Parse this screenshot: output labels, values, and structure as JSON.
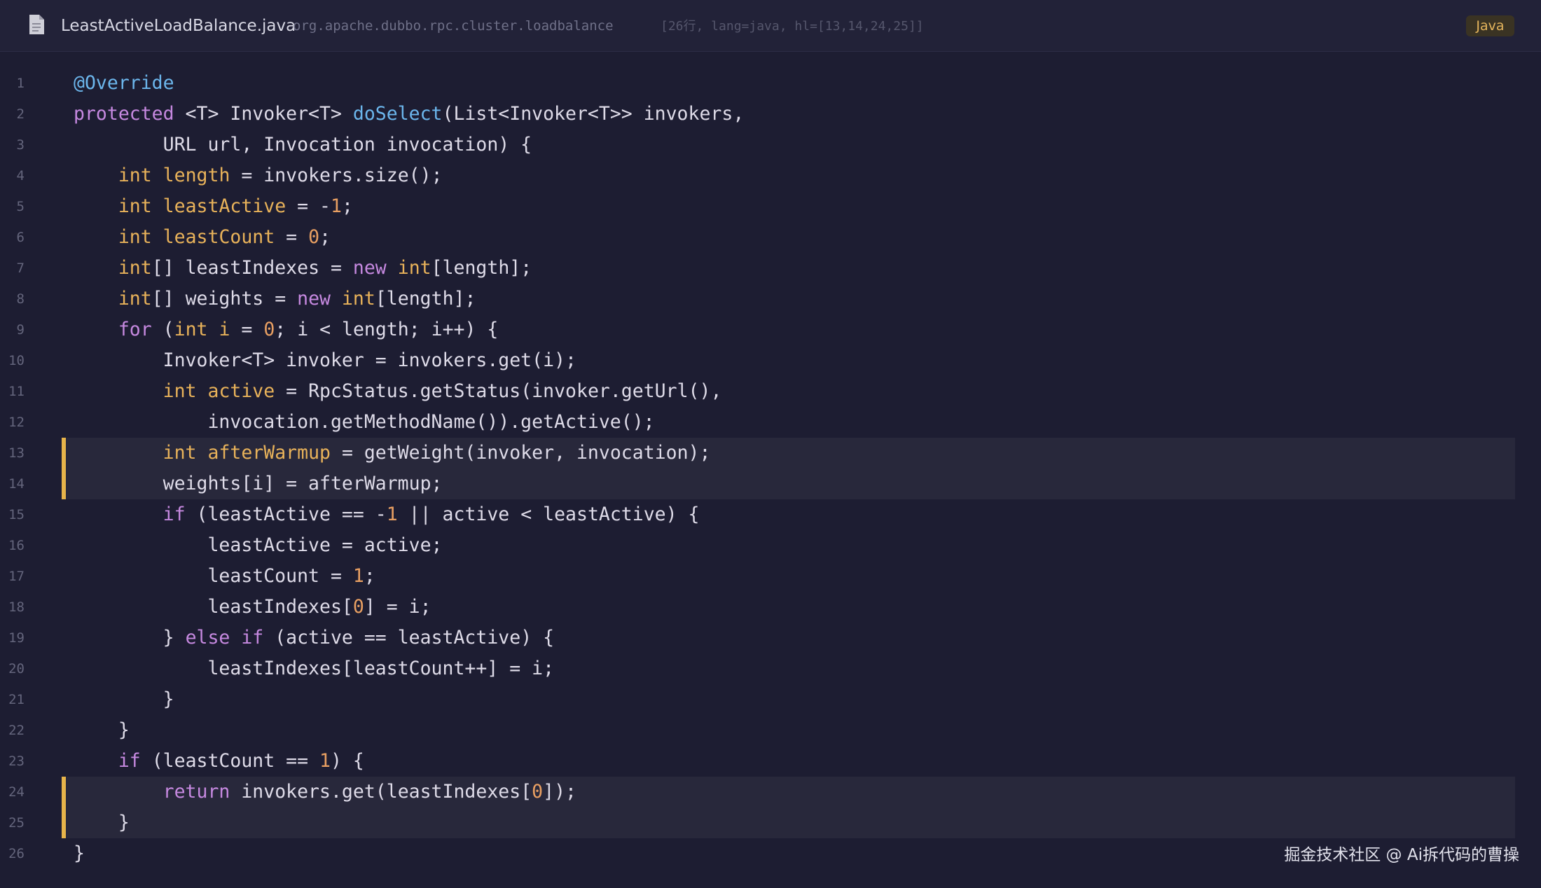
{
  "header": {
    "file_icon": "file-icon",
    "file_name": "LeastActiveLoadBalance.java",
    "package": "org.apache.dubbo.rpc.cluster.loadbalance",
    "meta": "[26行, lang=java, hl=[13,14,24,25]]",
    "language": "Java"
  },
  "colors": {
    "background": "#1d1d32",
    "header": "#222238",
    "highlight_bar": "#e7b44a",
    "keyword": "#c689e0",
    "type": "#e8b25a",
    "function": "#6cb6ec",
    "number": "#e89f62"
  },
  "highlighted_lines": [
    13,
    14,
    24,
    25
  ],
  "lines": [
    {
      "n": "1",
      "indent": "",
      "tokens": [
        [
          "an",
          "@Override"
        ]
      ]
    },
    {
      "n": "2",
      "indent": "",
      "tokens": [
        [
          "kw",
          "protected"
        ],
        [
          "p",
          " <T> Invoker<T> "
        ],
        [
          "fn",
          "doSelect"
        ],
        [
          "p",
          "(List<Invoker<T>> invokers,"
        ]
      ]
    },
    {
      "n": "3",
      "indent": "        ",
      "tokens": [
        [
          "p",
          "URL url, Invocation invocation) {"
        ]
      ]
    },
    {
      "n": "4",
      "indent": "    ",
      "tokens": [
        [
          "ty",
          "int"
        ],
        [
          "p",
          " "
        ],
        [
          "vr",
          "length"
        ],
        [
          "p",
          " = invokers.size();"
        ]
      ]
    },
    {
      "n": "5",
      "indent": "    ",
      "tokens": [
        [
          "ty",
          "int"
        ],
        [
          "p",
          " "
        ],
        [
          "vr",
          "leastActive"
        ],
        [
          "p",
          " = -"
        ],
        [
          "nm",
          "1"
        ],
        [
          "p",
          ";"
        ]
      ]
    },
    {
      "n": "6",
      "indent": "    ",
      "tokens": [
        [
          "ty",
          "int"
        ],
        [
          "p",
          " "
        ],
        [
          "vr",
          "leastCount"
        ],
        [
          "p",
          " = "
        ],
        [
          "nm",
          "0"
        ],
        [
          "p",
          ";"
        ]
      ]
    },
    {
      "n": "7",
      "indent": "    ",
      "tokens": [
        [
          "ty",
          "int"
        ],
        [
          "p",
          "[] leastIndexes = "
        ],
        [
          "kw",
          "new"
        ],
        [
          "p",
          " "
        ],
        [
          "ty",
          "int"
        ],
        [
          "p",
          "[length];"
        ]
      ]
    },
    {
      "n": "8",
      "indent": "    ",
      "tokens": [
        [
          "ty",
          "int"
        ],
        [
          "p",
          "[] weights = "
        ],
        [
          "kw",
          "new"
        ],
        [
          "p",
          " "
        ],
        [
          "ty",
          "int"
        ],
        [
          "p",
          "[length];"
        ]
      ]
    },
    {
      "n": "9",
      "indent": "    ",
      "tokens": [
        [
          "kw",
          "for"
        ],
        [
          "p",
          " ("
        ],
        [
          "ty",
          "int"
        ],
        [
          "p",
          " "
        ],
        [
          "vr",
          "i"
        ],
        [
          "p",
          " = "
        ],
        [
          "nm",
          "0"
        ],
        [
          "p",
          "; i < length; i++) {"
        ]
      ]
    },
    {
      "n": "10",
      "indent": "        ",
      "tokens": [
        [
          "p",
          "Invoker<T> invoker = invokers.get(i);"
        ]
      ]
    },
    {
      "n": "11",
      "indent": "        ",
      "tokens": [
        [
          "ty",
          "int"
        ],
        [
          "p",
          " "
        ],
        [
          "vr",
          "active"
        ],
        [
          "p",
          " = RpcStatus.getStatus(invoker.getUrl(),"
        ]
      ]
    },
    {
      "n": "12",
      "indent": "            ",
      "tokens": [
        [
          "p",
          "invocation.getMethodName()).getActive();"
        ]
      ]
    },
    {
      "n": "13",
      "indent": "        ",
      "tokens": [
        [
          "ty",
          "int"
        ],
        [
          "p",
          " "
        ],
        [
          "vr",
          "afterWarmup"
        ],
        [
          "p",
          " = getWeight(invoker, invocation);"
        ]
      ]
    },
    {
      "n": "14",
      "indent": "        ",
      "tokens": [
        [
          "p",
          "weights[i] = afterWarmup;"
        ]
      ]
    },
    {
      "n": "15",
      "indent": "        ",
      "tokens": [
        [
          "kw",
          "if"
        ],
        [
          "p",
          " (leastActive == -"
        ],
        [
          "nm",
          "1"
        ],
        [
          "p",
          " || active < leastActive) {"
        ]
      ]
    },
    {
      "n": "16",
      "indent": "            ",
      "tokens": [
        [
          "p",
          "leastActive = active;"
        ]
      ]
    },
    {
      "n": "17",
      "indent": "            ",
      "tokens": [
        [
          "p",
          "leastCount = "
        ],
        [
          "nm",
          "1"
        ],
        [
          "p",
          ";"
        ]
      ]
    },
    {
      "n": "18",
      "indent": "            ",
      "tokens": [
        [
          "p",
          "leastIndexes["
        ],
        [
          "nm",
          "0"
        ],
        [
          "p",
          "] = i;"
        ]
      ]
    },
    {
      "n": "19",
      "indent": "        ",
      "tokens": [
        [
          "p",
          "} "
        ],
        [
          "kw",
          "else if"
        ],
        [
          "p",
          " (active == leastActive) {"
        ]
      ]
    },
    {
      "n": "20",
      "indent": "            ",
      "tokens": [
        [
          "p",
          "leastIndexes[leastCount++] = i;"
        ]
      ]
    },
    {
      "n": "21",
      "indent": "        ",
      "tokens": [
        [
          "p",
          "}"
        ]
      ]
    },
    {
      "n": "22",
      "indent": "    ",
      "tokens": [
        [
          "p",
          "}"
        ]
      ]
    },
    {
      "n": "23",
      "indent": "    ",
      "tokens": [
        [
          "kw",
          "if"
        ],
        [
          "p",
          " (leastCount == "
        ],
        [
          "nm",
          "1"
        ],
        [
          "p",
          ") {"
        ]
      ]
    },
    {
      "n": "24",
      "indent": "        ",
      "tokens": [
        [
          "kw",
          "return"
        ],
        [
          "p",
          " invokers.get(leastIndexes["
        ],
        [
          "nm",
          "0"
        ],
        [
          "p",
          "]);"
        ]
      ]
    },
    {
      "n": "25",
      "indent": "    ",
      "tokens": [
        [
          "p",
          "}"
        ]
      ]
    },
    {
      "n": "26",
      "indent": "",
      "tokens": [
        [
          "p",
          "}"
        ]
      ]
    }
  ],
  "watermark": "掘金技术社区 @ Ai拆代码的曹操"
}
